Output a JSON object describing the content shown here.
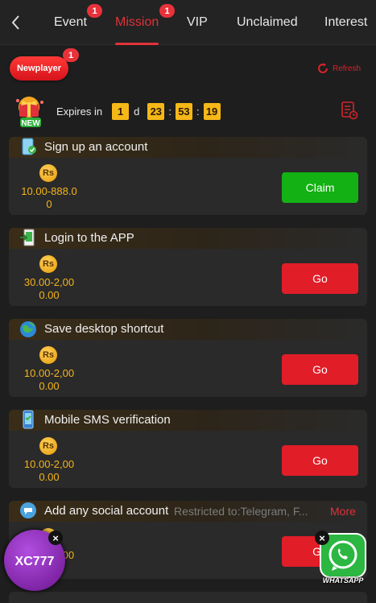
{
  "tabs": [
    {
      "label": "Event",
      "badge": "1",
      "active": false
    },
    {
      "label": "Mission",
      "badge": "1",
      "active": true
    },
    {
      "label": "VIP",
      "badge": "",
      "active": false
    },
    {
      "label": "Unclaimed",
      "badge": "",
      "active": false
    },
    {
      "label": "Interest",
      "badge": "",
      "active": false
    }
  ],
  "newplayer": {
    "label": "Newplayer",
    "badge": "1"
  },
  "refresh_label": "Refresh",
  "gift_label": "NEW",
  "expires": {
    "label": "Expires in",
    "days": "1",
    "day_unit": "d",
    "hours": "23",
    "minutes": "53",
    "seconds": "19",
    "sep": ":"
  },
  "currency_symbol": "Rs",
  "tasks": [
    {
      "title": "Sign up an account",
      "amount_line1": "10.00-888.0",
      "amount_line2": "0",
      "button": "Claim",
      "button_type": "claim"
    },
    {
      "title": "Login to the APP",
      "amount_line1": "30.00-2,00",
      "amount_line2": "0.00",
      "button": "Go",
      "button_type": "go"
    },
    {
      "title": "Save desktop shortcut",
      "amount_line1": "10.00-2,00",
      "amount_line2": "0.00",
      "button": "Go",
      "button_type": "go"
    },
    {
      "title": "Mobile SMS verification",
      "amount_line1": "10.00-2,00",
      "amount_line2": "0.00",
      "button": "Go",
      "button_type": "go"
    },
    {
      "title": "Add any social account",
      "restrict": "Restricted to:Telegram, F...",
      "more": "More",
      "amount_line1": "10.00-2,00",
      "amount_line2": "0.00",
      "button": "Go",
      "button_type": "go"
    }
  ],
  "float_widgets": {
    "xc_label": "XC777",
    "whatsapp_label": "WHATSAPP",
    "close": "×"
  },
  "colors": {
    "accent": "#e0323a",
    "claim": "#13b113",
    "go": "#e11d28",
    "gold": "#f5b419"
  }
}
